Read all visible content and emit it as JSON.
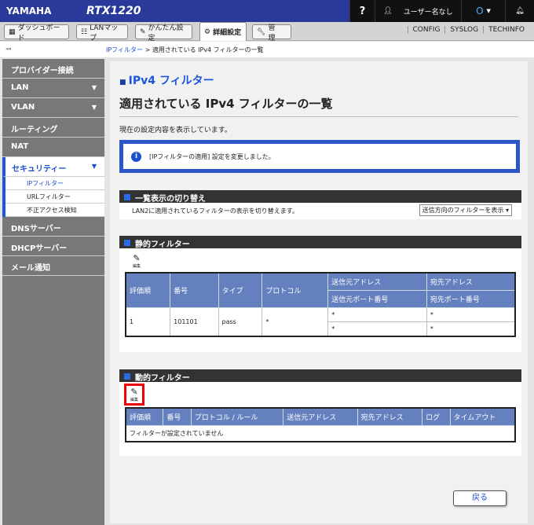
{
  "header": {
    "brand": "YAMAHA",
    "model": "RTX1220",
    "help": "?",
    "user": "ユーザー名なし",
    "status_icon": "O",
    "bell": "bell-icon"
  },
  "tabs": [
    {
      "label": "ダッシュボード"
    },
    {
      "label": "LANマップ"
    },
    {
      "label": "かんたん設定"
    },
    {
      "label": "詳細設定"
    },
    {
      "label": "管　理"
    }
  ],
  "top_links": [
    "CONFIG",
    "SYSLOG",
    "TECHINFO"
  ],
  "breadcrumb": {
    "collapse": "◂◂",
    "link": "IPフィルター",
    "sep": " > ",
    "current": "適用されている IPv4 フィルターの一覧"
  },
  "sidebar": {
    "items": [
      "プロバイダー接続",
      "LAN",
      "VLAN",
      "ルーティング",
      "NAT",
      "セキュリティー"
    ],
    "sub": [
      "IPフィルター",
      "URLフィルター",
      "不正アクセス検知"
    ],
    "after": [
      "DNSサーバー",
      "DHCPサーバー",
      "メール通知"
    ]
  },
  "main": {
    "section_title": "IPv4 フィルター",
    "title": "適用されている IPv4 フィルターの一覧",
    "desc": "現在の設定内容を表示しています。",
    "info": "[IPフィルターの適用] 設定を変更しました。",
    "switch": {
      "title": "一覧表示の切り替え",
      "text": "LAN2に適用されているフィルターの表示を切り替えます。",
      "select": "送信方向のフィルターを表示"
    },
    "static": {
      "title": "静的フィルター",
      "edit": "編集",
      "headers": [
        "評価順",
        "番号",
        "タイプ",
        "プロトコル",
        "送信元アドレス",
        "宛先アドレス",
        "送信元ポート番号",
        "宛先ポート番号"
      ],
      "rows": [
        {
          "order": "1",
          "number": "101101",
          "type": "pass",
          "protocol": "*",
          "src": "*",
          "dst": "*",
          "src_port": "*",
          "dst_port": "*"
        }
      ]
    },
    "dynamic": {
      "title": "動的フィルター",
      "edit": "編集",
      "headers": [
        "評価順",
        "番号",
        "プロトコル / ルール",
        "送信元アドレス",
        "宛先アドレス",
        "ログ",
        "タイムアウト"
      ],
      "empty": "フィルターが設定されていません"
    },
    "back": "戻る"
  }
}
